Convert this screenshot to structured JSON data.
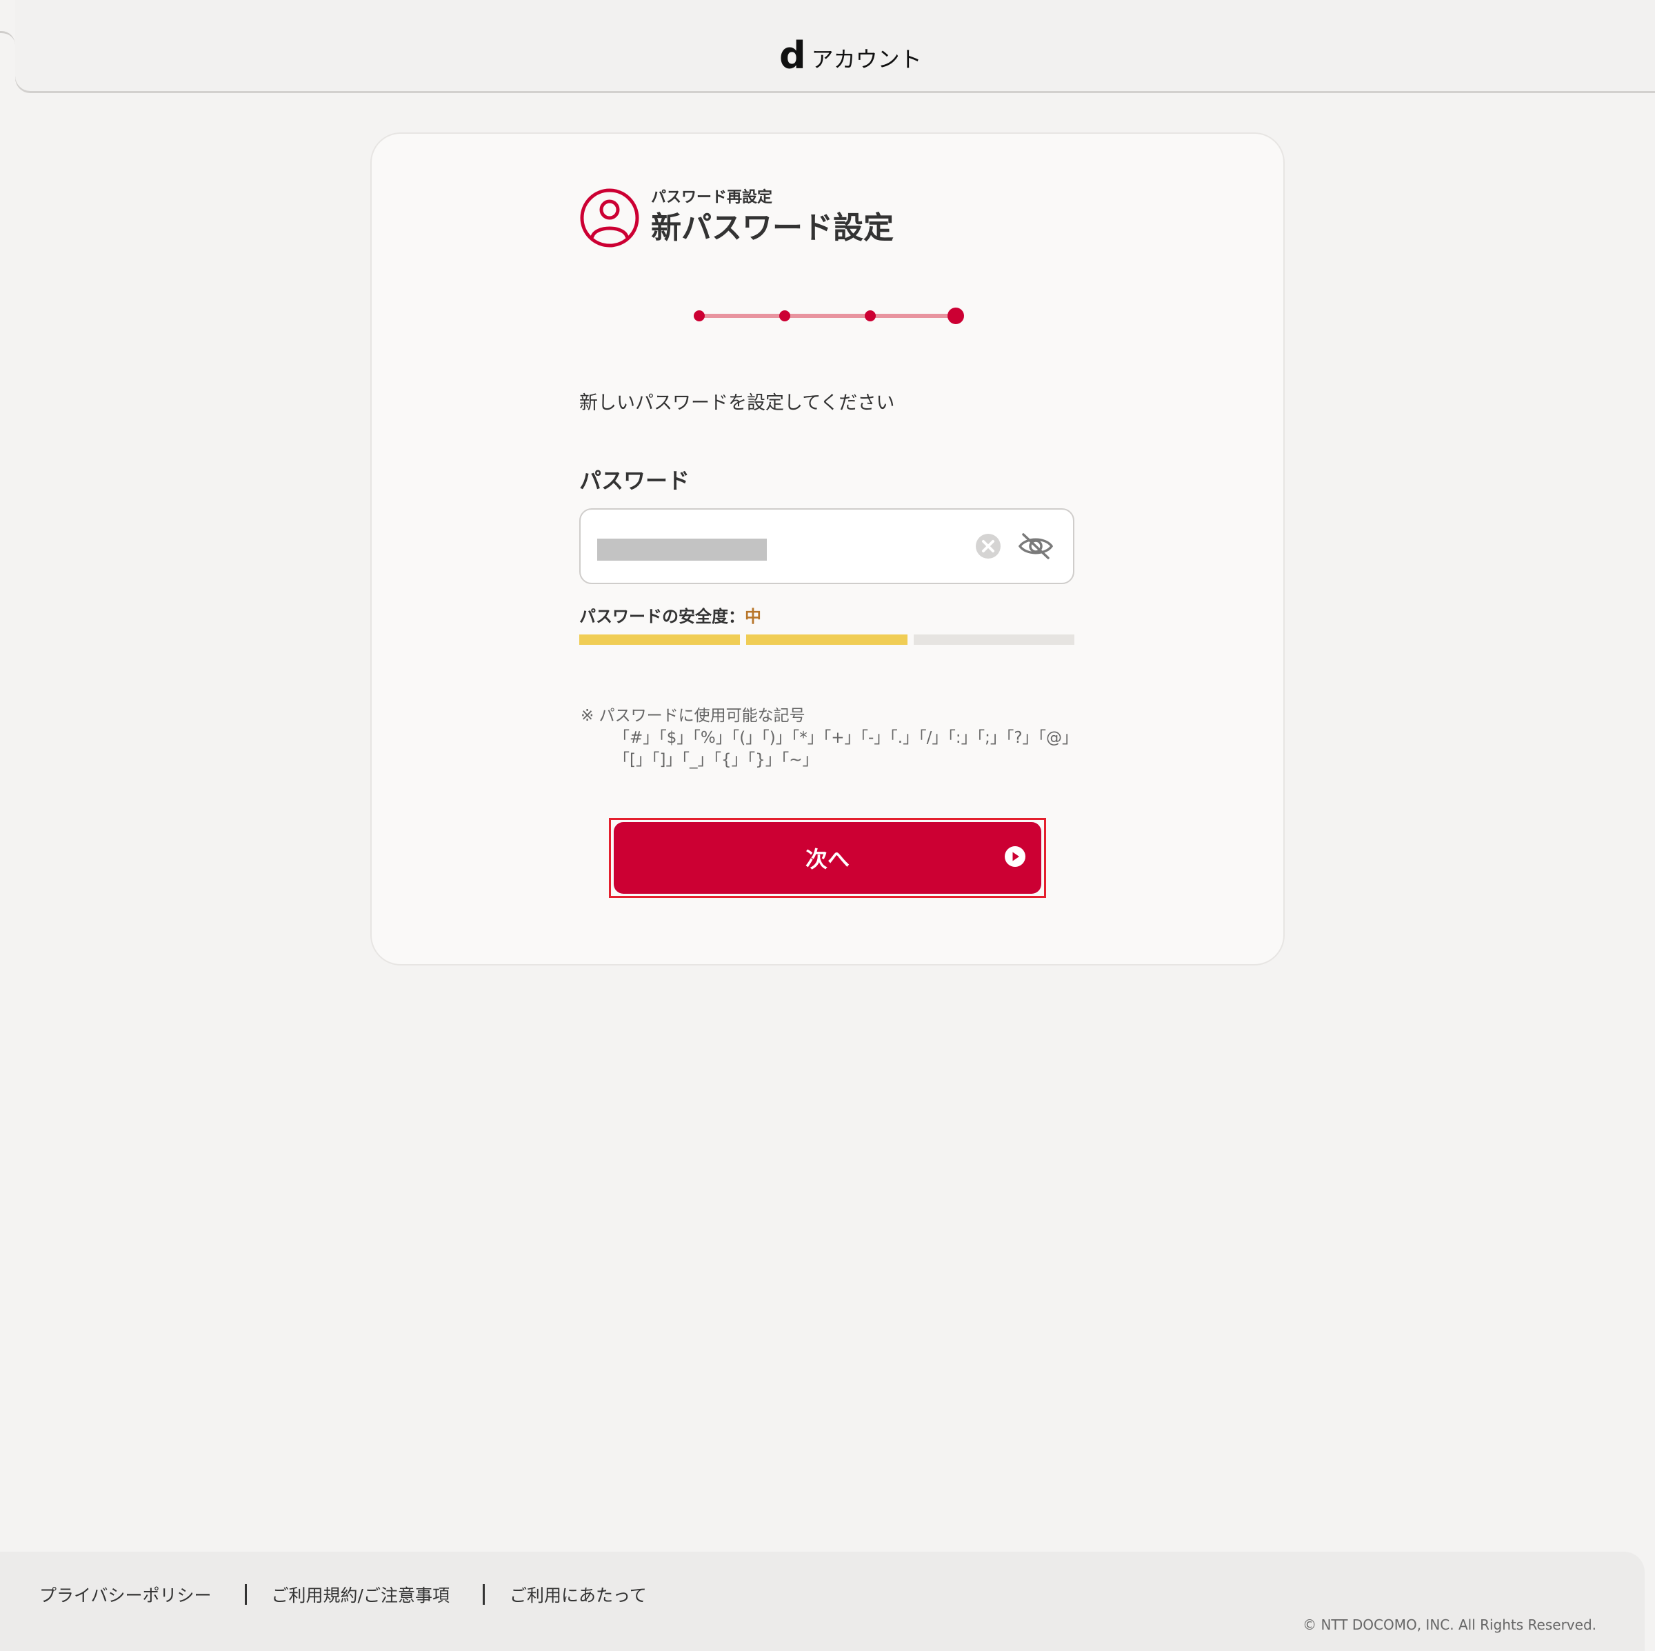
{
  "header": {
    "logo_mark": "d",
    "logo_text": "アカウント"
  },
  "page": {
    "subtitle": "パスワード再設定",
    "title": "新パスワード設定",
    "instruction": "新しいパスワードを設定してください",
    "steps": {
      "total": 4,
      "current": 4
    }
  },
  "password": {
    "label": "パスワード",
    "clear_icon": "clear-icon",
    "visibility_icon": "eye-off-icon",
    "strength_label": "パスワードの安全度：",
    "strength_value": "中",
    "strength_level": 2,
    "strength_max": 3
  },
  "note": {
    "line1": "※ パスワードに使用可能な記号",
    "line2": "「#」「$」「%」「(」「)」「*」「+」「-」「.」「/」「:」「;」「?」「@」",
    "line3": "「[」「]」「_」「{」「}」「~」"
  },
  "next_button": {
    "label": "次へ"
  },
  "footer": {
    "links": [
      "プライバシーポリシー",
      "ご利用規約/ご注意事項",
      "ご利用にあたって"
    ],
    "copyright": "© NTT DOCOMO, INC. All Rights Reserved."
  },
  "colors": {
    "brand": "#cc0033",
    "step_line": "#e8949f",
    "strength_on": "#f0cd55",
    "strength_off": "#e6e4e1",
    "strength_text": "#b8762a"
  }
}
